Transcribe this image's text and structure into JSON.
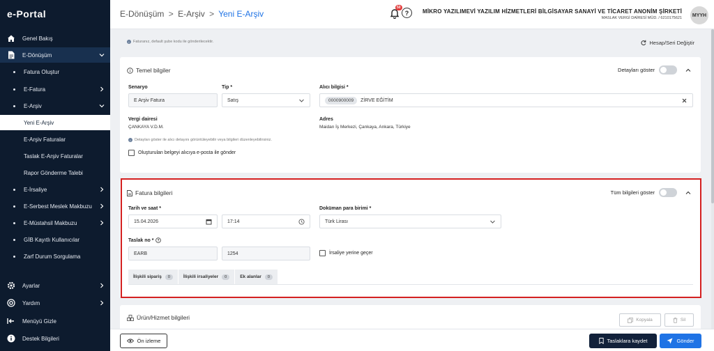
{
  "app": {
    "logo": "e-Portal"
  },
  "sidebar": {
    "items": [
      {
        "label": "Genel Bakış",
        "icon": "home-icon"
      },
      {
        "label": "E-Dönüşüm",
        "icon": "document-icon"
      },
      {
        "label": "Fatura Oluştur"
      },
      {
        "label": "E-Fatura"
      },
      {
        "label": "E-Arşiv"
      },
      {
        "label": "Yeni E-Arşiv"
      },
      {
        "label": "E-Arşiv Faturalar"
      },
      {
        "label": "Taslak E-Arşiv Faturalar"
      },
      {
        "label": "Rapor Gönderme Talebi"
      },
      {
        "label": "E-İrsaliye"
      },
      {
        "label": "E-Serbest Meslek Makbuzu"
      },
      {
        "label": "E-Müstahsil Makbuzu"
      },
      {
        "label": "GİB Kayıtlı Kullanıcılar"
      },
      {
        "label": "Zarf Durum Sorgulama"
      },
      {
        "label": "Ayarlar",
        "icon": "gear-icon"
      },
      {
        "label": "Yardım",
        "icon": "lifebuoy-icon"
      },
      {
        "label": "Menüyü Gizle",
        "icon": "collapse-icon"
      },
      {
        "label": "Destek Bilgileri",
        "icon": "info-icon"
      }
    ]
  },
  "header": {
    "breadcrumb": [
      "E-Dönüşüm",
      "E-Arşiv",
      "Yeni E-Arşiv"
    ],
    "breadcrumb_sep": ">",
    "notification_count": "50",
    "help_glyph": "?",
    "company_name": "MİKRO YAZILIMEVİ YAZILIM HİZMETLERİ BİLGİSAYAR SANAYİ VE TİCARET ANONİM ŞİRKETİ",
    "company_sub": "MASLAK VERGİ DAİRESİ MÜD. / 6210175621",
    "avatar": "MYYH"
  },
  "main": {
    "info_line": "Faturanız, default şube kodu ile gönderilecektir.",
    "hesap_link": "Hesap/Seri Değiştir"
  },
  "temel": {
    "title": "Temel bilgiler",
    "toggle_label": "Detayları göster",
    "senaryo_label": "Senaryo",
    "senaryo_value": "E Arşiv Fatura",
    "tip_label": "Tip *",
    "tip_value": "Satış",
    "alici_label": "Alıcı bilgisi *",
    "alici_vkn": "0000900009",
    "alici_name": "ZİRVE EĞİTİM",
    "vergi_label": "Vergi dairesi",
    "vergi_value": "ÇANKAYA V.D.M.",
    "adres_label": "Adres",
    "adres_value": "Maidan İş Merkezi, Çankaya, Ankara, Türkiye",
    "note": "Detayları göster ile alıcı detayını görüntüleyebilir veya bilgileri düzenleyebilirsiniz.",
    "email_checkbox": "Oluşturulan belgeyi alıcıya e-posta ile gönder"
  },
  "fatura": {
    "title": "Fatura bilgileri",
    "toggle_label": "Tüm bilgileri göster",
    "tarih_label": "Tarih ve saat *",
    "tarih_value": "15.04.2026",
    "saat_value": "17:14",
    "doviz_label": "Doküman para birimi *",
    "doviz_value": "Türk Lirası",
    "taslak_label": "Taslak no *",
    "taslak_prefix": "EARB",
    "taslak_no": "1254",
    "irsaliye_checkbox": "İrsaliye yerine geçer",
    "tabs": [
      {
        "label": "İlişkili sipariş",
        "count": "0"
      },
      {
        "label": "İlişkili irsaliyeler",
        "count": "0"
      },
      {
        "label": "Ek alanlar",
        "count": "0"
      }
    ]
  },
  "urun": {
    "title": "Ürün/Hizmet bilgileri",
    "kopyala": "Kopyala",
    "sil": "Sil"
  },
  "footer": {
    "onizleme": "Ön izleme",
    "taslak": "Taslaklara kaydet",
    "gonder": "Gönder"
  },
  "colors": {
    "sidebar_bg": "#0d1b2e",
    "accent": "#1f73e5",
    "highlight": "#d42020",
    "primary_dark": "#12213a"
  }
}
